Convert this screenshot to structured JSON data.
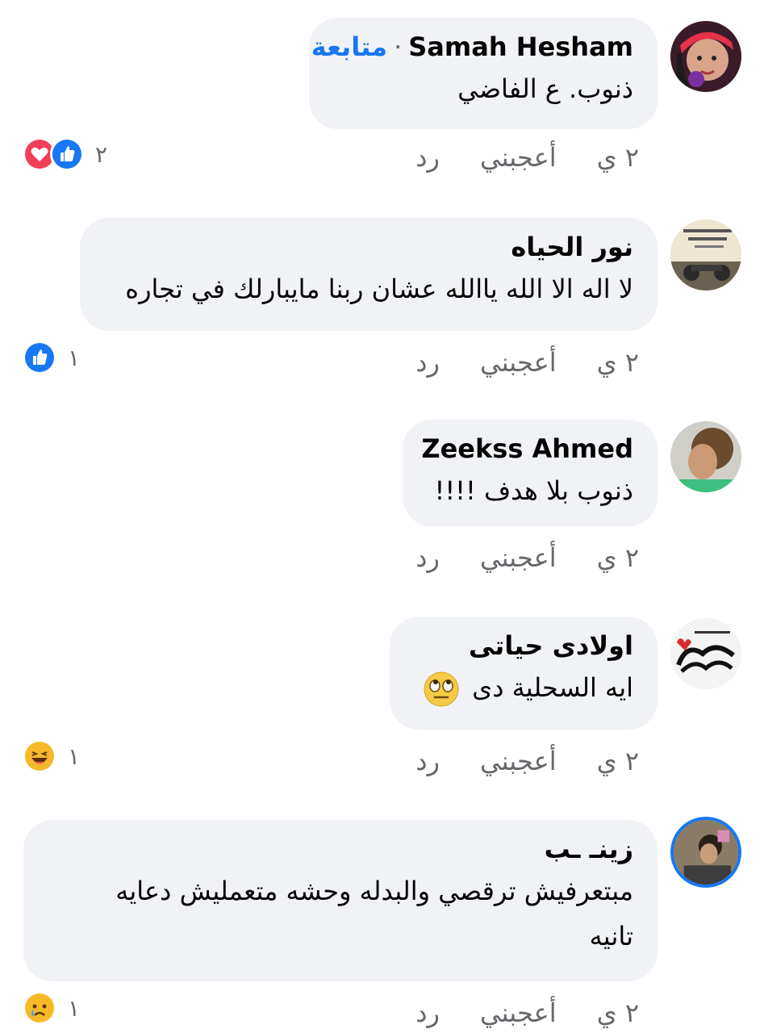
{
  "comments": [
    {
      "name": "Samah Hesham",
      "follow_label": "متابعة",
      "text": "ذنوب. ع الفاضي",
      "time": "٢ ي",
      "like_label": "أعجبني",
      "reply_label": "رد",
      "reactions": [
        "like-icon",
        "love-icon"
      ],
      "reaction_count": "٢"
    },
    {
      "name": "نور الحياه",
      "text": "لا اله الا الله ياالله عشان ربنا مايبارلك في تجاره",
      "time": "٢ ي",
      "like_label": "أعجبني",
      "reply_label": "رد",
      "reactions": [
        "like-icon"
      ],
      "reaction_count": "١"
    },
    {
      "name": "Zeekss Ahmed",
      "text": "ذنوب بلا هدف !!!!",
      "time": "٢ ي",
      "like_label": "أعجبني",
      "reply_label": "رد",
      "reactions": [],
      "reaction_count": ""
    },
    {
      "name": "اولادى حياتى",
      "text": "ايه السحلية دى",
      "inline_emoji": "eye-roll-emoji",
      "time": "٢ ي",
      "like_label": "أعجبني",
      "reply_label": "رد",
      "reactions": [
        "haha-icon"
      ],
      "reaction_count": "١"
    },
    {
      "name": "زينـ ـب",
      "text_line1": "مبتعرفيش ترقصي والبدله وحشه متعمليش دعايه",
      "text_line2": "تانيه",
      "time": "٢ ي",
      "like_label": "أعجبني",
      "reply_label": "رد",
      "reactions": [
        "sad-icon"
      ],
      "reaction_count": "١"
    }
  ],
  "colors": {
    "bubble": "#f0f2f5",
    "link_blue": "#1877f2",
    "meta_gray": "#65676b",
    "love_red": "#f33e58"
  }
}
